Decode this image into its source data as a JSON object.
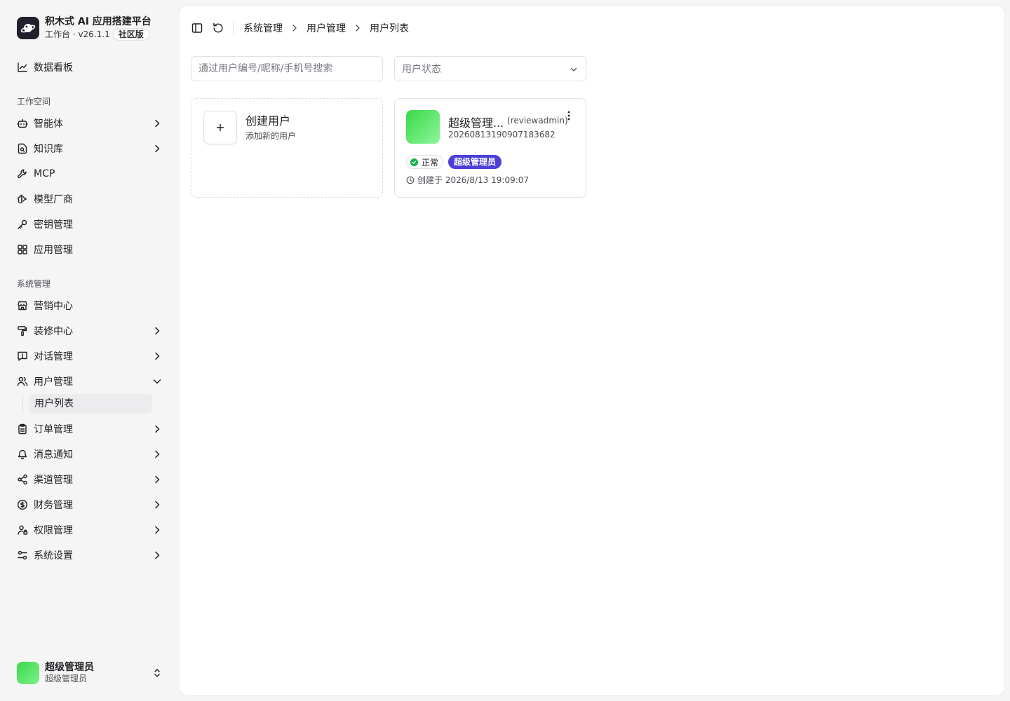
{
  "brand": {
    "title": "积木式 AI 应用搭建平台",
    "workspace": "工作台 · v26.1.1",
    "edition": "社区版",
    "logo_icon": "planet-logo-icon"
  },
  "sidebar": {
    "dashboard": "数据看板",
    "workspace_section": "工作空间",
    "workspace_items": [
      {
        "label": "智能体",
        "icon": "bot-icon",
        "has_children": true
      },
      {
        "label": "知识库",
        "icon": "file-search-icon",
        "has_children": true
      },
      {
        "label": "MCP",
        "icon": "wrench-icon",
        "has_children": false
      },
      {
        "label": "模型厂商",
        "icon": "brain-icon",
        "has_children": false
      },
      {
        "label": "密钥管理",
        "icon": "key-icon",
        "has_children": false
      },
      {
        "label": "应用管理",
        "icon": "grid-icon",
        "has_children": false
      }
    ],
    "system_section": "系统管理",
    "system_items": [
      {
        "label": "营销中心",
        "icon": "store-icon",
        "has_children": false
      },
      {
        "label": "装修中心",
        "icon": "paint-roller-icon",
        "has_children": true
      },
      {
        "label": "对话管理",
        "icon": "message-alert-icon",
        "has_children": true
      },
      {
        "label": "用户管理",
        "icon": "users-icon",
        "has_children": true,
        "expanded": true
      },
      {
        "label": "订单管理",
        "icon": "clipboard-icon",
        "has_children": true
      },
      {
        "label": "消息通知",
        "icon": "bell-icon",
        "has_children": true
      },
      {
        "label": "渠道管理",
        "icon": "share-icon",
        "has_children": true
      },
      {
        "label": "财务管理",
        "icon": "dollar-circle-icon",
        "has_children": true
      },
      {
        "label": "权限管理",
        "icon": "user-lock-icon",
        "has_children": true
      },
      {
        "label": "系统设置",
        "icon": "sliders-icon",
        "has_children": true
      }
    ],
    "active_sub_item": "用户列表"
  },
  "current_user": {
    "name": "超级管理员",
    "role": "超级管理员"
  },
  "breadcrumb": [
    "系统管理",
    "用户管理",
    "用户列表"
  ],
  "filters": {
    "search_placeholder": "通过用户编号/昵称/手机号搜索",
    "status_placeholder": "用户状态"
  },
  "create_card": {
    "title": "创建用户",
    "description": "添加新的用户"
  },
  "users": [
    {
      "nickname": "超级管理...",
      "username": "(reviewadmin)",
      "user_no": "20260813190907183682",
      "status": "正常",
      "role": "超级管理员",
      "created": "创建于 2026/8/13 19:09:07"
    }
  ],
  "colors": {
    "role_badge": "#4b3fd6",
    "status_ok": "#16b34a",
    "avatar_green": "#38d94a"
  }
}
